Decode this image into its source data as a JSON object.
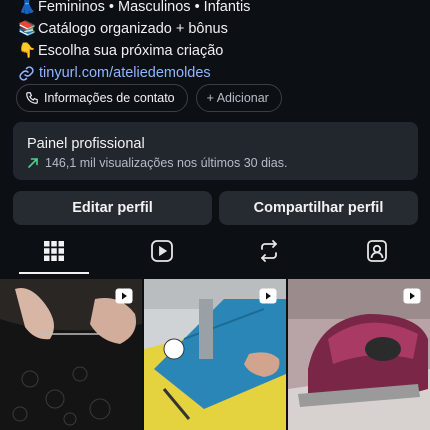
{
  "bio": {
    "line1": {
      "emoji": "👗",
      "text": "Femininos • Masculinos • Infantis"
    },
    "line2": {
      "emoji": "📚",
      "text": "Catálogo organizado + bônus"
    },
    "line3": {
      "emoji": "👇",
      "text": "Escolha sua próxima criação"
    },
    "link": "tinyurl.com/ateliedemoldes"
  },
  "chips": {
    "contact": "Informações de contato",
    "add": "+ Adicionar"
  },
  "professional_panel": {
    "title": "Painel profissional",
    "stat": "146,1 mil visualizações nos últimos 30 dias."
  },
  "buttons": {
    "edit": "Editar perfil",
    "share": "Compartilhar perfil"
  },
  "tabs": [
    "grid-icon",
    "reels-icon",
    "reposts-icon",
    "tagged-icon"
  ],
  "colors": {
    "link": "#8fb6ff",
    "accent_green": "#4fd18b",
    "background": "#0c0f14"
  }
}
